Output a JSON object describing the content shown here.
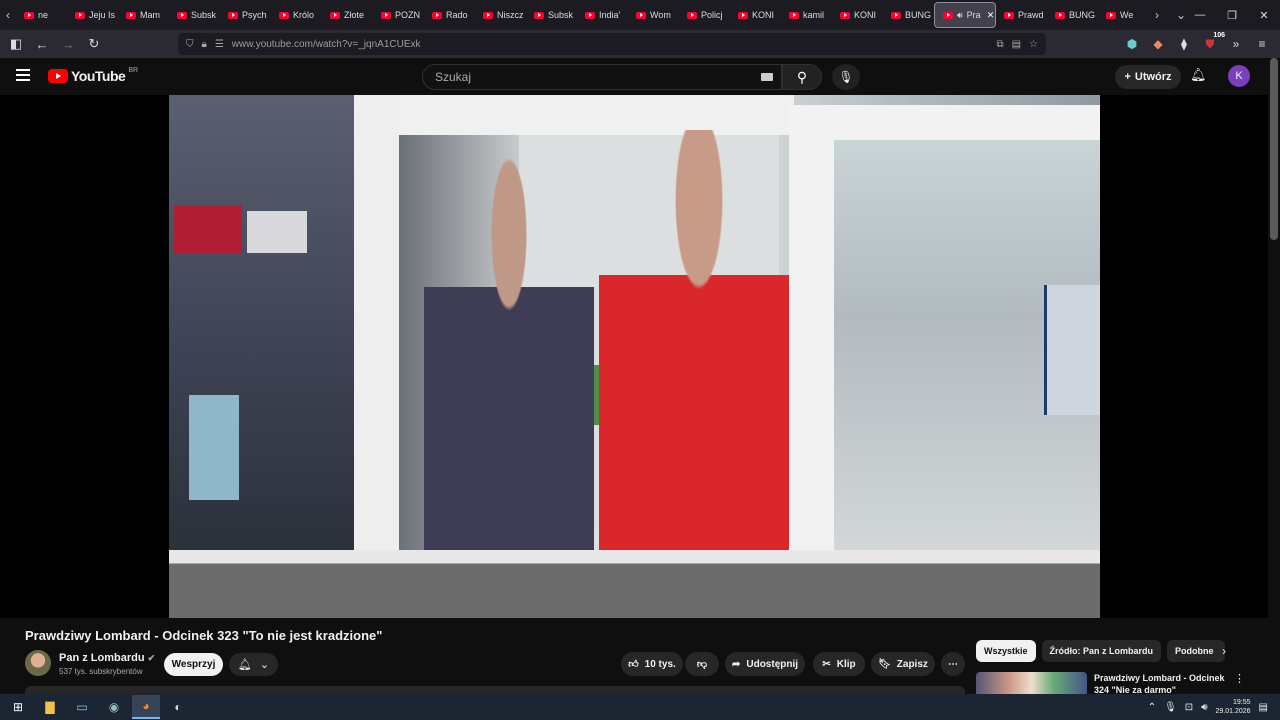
{
  "browser": {
    "tabs": [
      {
        "label": "ne"
      },
      {
        "label": "Jeju Is"
      },
      {
        "label": "Mam"
      },
      {
        "label": "Subsk"
      },
      {
        "label": "Psych"
      },
      {
        "label": "Królo"
      },
      {
        "label": "Złote"
      },
      {
        "label": "POZN"
      },
      {
        "label": "Rado"
      },
      {
        "label": "Niszcz"
      },
      {
        "label": "Subsk"
      },
      {
        "label": "India'"
      },
      {
        "label": "Wom"
      },
      {
        "label": "Policj"
      },
      {
        "label": "KONI"
      },
      {
        "label": "kamil"
      },
      {
        "label": "KONI"
      },
      {
        "label": "BUNG"
      },
      {
        "label": "Pra",
        "active": true
      },
      {
        "label": "Prawd"
      },
      {
        "label": "BUNG"
      },
      {
        "label": "We"
      }
    ],
    "url": "www.youtube.com/watch?v=_jqnA1CUExk",
    "extension_badge": "106"
  },
  "youtube": {
    "logo_text": "YouTube",
    "country_code": "BR",
    "search_placeholder": "Szukaj",
    "create_label": "Utwórz",
    "avatar_letter": "K"
  },
  "video": {
    "title": "Prawdziwy Lombard - Odcinek 323 \"To nie jest kradzione\"",
    "channel_name": "Pan z Lombardu",
    "subscribers": "537 tys. subskrybentów",
    "support_label": "Wesprzyj",
    "likes": "10 tys.",
    "share_label": "Udostępnij",
    "clip_label": "Klip",
    "save_label": "Zapisz"
  },
  "filters": [
    "Wszystkie",
    "Źródło: Pan z Lombardu",
    "Podobne"
  ],
  "recommendation": {
    "title": "Prawdziwy Lombard - Odcinek 324 \"Nie za darmo\""
  },
  "taskbar": {
    "time": "19:55",
    "date": "29.01.2026"
  }
}
